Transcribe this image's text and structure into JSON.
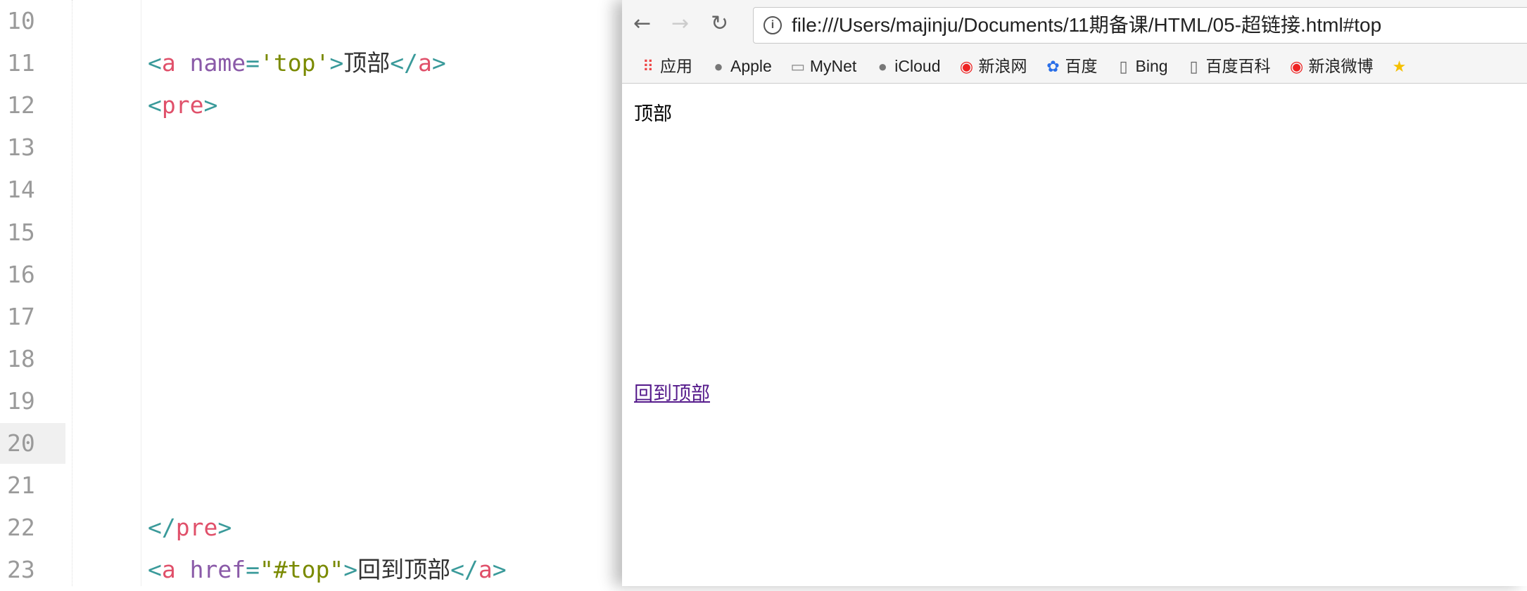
{
  "editor": {
    "line_numbers": [
      "10",
      "11",
      "12",
      "13",
      "14",
      "15",
      "16",
      "17",
      "18",
      "19",
      "20",
      "21",
      "22",
      "23"
    ],
    "active_line": "20",
    "code": {
      "l11": {
        "open_lt": "<",
        "tag": "a",
        "attr": " name",
        "eq": "=",
        "val": "'top'",
        "gt": ">",
        "text": "顶部",
        "close_lt": "</",
        "close_tag": "a",
        "close_gt": ">"
      },
      "l12": {
        "lt": "<",
        "tag": "pre",
        "gt": ">"
      },
      "l22": {
        "lt": "</",
        "tag": "pre",
        "gt": ">"
      },
      "l23": {
        "open_lt": "<",
        "tag": "a",
        "attr": " href",
        "eq": "=",
        "val": "\"#top\"",
        "gt": ">",
        "text": "回到顶部",
        "close_lt": "</",
        "close_tag": "a",
        "close_gt": ">"
      }
    },
    "colors": {
      "bracket": "#3a9a9a",
      "tag": "#e0506a",
      "attribute": "#8a5aa8",
      "string": "#7a8a00"
    }
  },
  "browser": {
    "back": "←",
    "forward": "→",
    "reload": "↻",
    "url": "file:///Users/majinju/Documents/11期备课/HTML/05-超链接.html#top",
    "bookmarks": [
      {
        "icon": "apps-grid-icon",
        "glyph": "⠿",
        "label": "应用"
      },
      {
        "icon": "apple-icon",
        "glyph": "●",
        "label": "Apple"
      },
      {
        "icon": "folder-icon",
        "glyph": "▭",
        "label": "MyNet"
      },
      {
        "icon": "apple-icon",
        "glyph": "●",
        "label": "iCloud"
      },
      {
        "icon": "weibo-icon",
        "glyph": "◉",
        "label": "新浪网"
      },
      {
        "icon": "baidu-icon",
        "glyph": "✿",
        "label": "百度"
      },
      {
        "icon": "page-icon",
        "glyph": "▯",
        "label": "Bing"
      },
      {
        "icon": "page-icon",
        "glyph": "▯",
        "label": "百度百科"
      },
      {
        "icon": "weibo-icon",
        "glyph": "◉",
        "label": "新浪微博"
      },
      {
        "icon": "star-icon",
        "glyph": "★",
        "label": ""
      }
    ],
    "page": {
      "anchor_text": "顶部",
      "link_text": "回到顶部"
    }
  }
}
